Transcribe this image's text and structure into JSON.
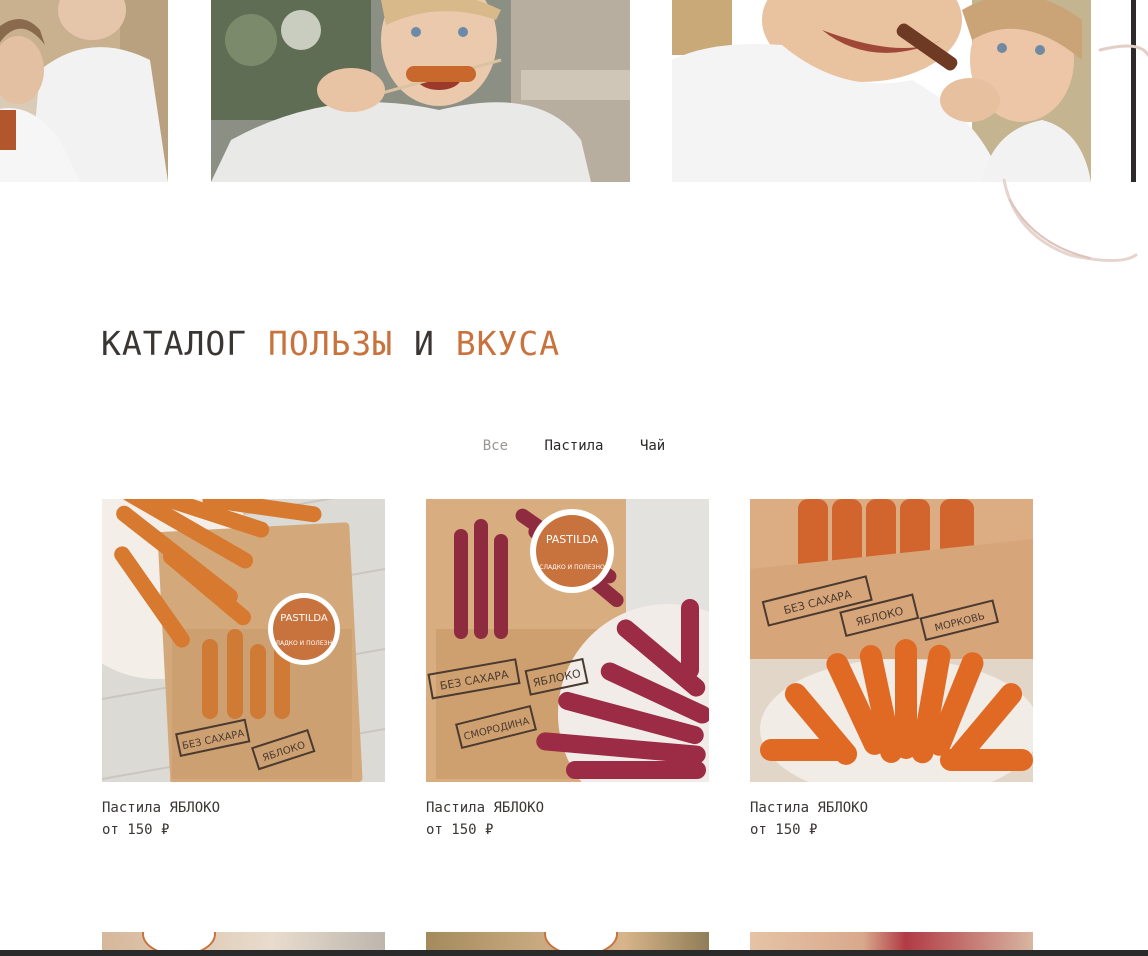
{
  "catalog": {
    "title_part1": "КАТАЛОГ ",
    "title_accent1": "ПОЛЬЗЫ",
    "title_part2": " И ",
    "title_accent2": "ВКУСА"
  },
  "filters": {
    "tabs": [
      {
        "label": "Все",
        "active": true
      },
      {
        "label": "Пастила",
        "active": false
      },
      {
        "label": "Чай",
        "active": false
      }
    ]
  },
  "products": [
    {
      "name": "Пастила ЯБЛОКО",
      "price": "от 150 ₽",
      "stamps": [
        "БЕЗ САХАРА",
        "ЯБЛОКО"
      ]
    },
    {
      "name": "Пастила ЯБЛОКО",
      "price": "от 150 ₽",
      "stamps": [
        "БЕЗ САХАРА",
        "ЯБЛОКО",
        "СМОРОДИНА"
      ]
    },
    {
      "name": "Пастила ЯБЛОКО",
      "price": "от 150 ₽",
      "stamps": [
        "БЕЗ САХАРА",
        "ЯБЛОКО",
        "МОРКОВЬ"
      ]
    }
  ],
  "seal_text": {
    "brand": "PASTILDA",
    "tagline": "СЛАДКО И ПОЛЕЗНО"
  },
  "colors": {
    "accent": "#c8733d",
    "text": "#3a3634",
    "tab_inactive": "#9a9592"
  }
}
